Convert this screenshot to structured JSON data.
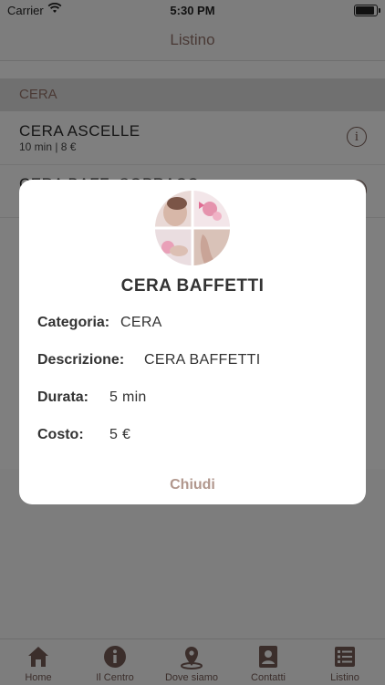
{
  "status": {
    "carrier": "Carrier",
    "time": "5:30 PM"
  },
  "nav": {
    "title": "Listino"
  },
  "section": {
    "title": "CERA"
  },
  "list": [
    {
      "name": "CERA  ASCELLE",
      "meta": "10 min | 8 €"
    },
    {
      "name": "CERA  BAFF+SOPRACC",
      "meta": ""
    }
  ],
  "modal": {
    "title": "CERA  BAFFETTI",
    "fields": {
      "categoria": {
        "label": "Categoria:",
        "value": "CERA"
      },
      "descrizione": {
        "label": "Descrizione:",
        "value": "CERA  BAFFETTI"
      },
      "durata": {
        "label": "Durata:",
        "value": "5 min"
      },
      "costo": {
        "label": "Costo:",
        "value": "5 €"
      }
    },
    "close_label": "Chiudi"
  },
  "tabs": [
    {
      "label": "Home",
      "icon": "home-icon"
    },
    {
      "label": "Il Centro",
      "icon": "info-icon"
    },
    {
      "label": "Dove siamo",
      "icon": "map-pin-icon"
    },
    {
      "label": "Contatti",
      "icon": "contact-icon"
    },
    {
      "label": "Listino",
      "icon": "list-icon"
    }
  ],
  "colors": {
    "accent": "#b1978d",
    "icon_dark": "#3b2e2b"
  }
}
